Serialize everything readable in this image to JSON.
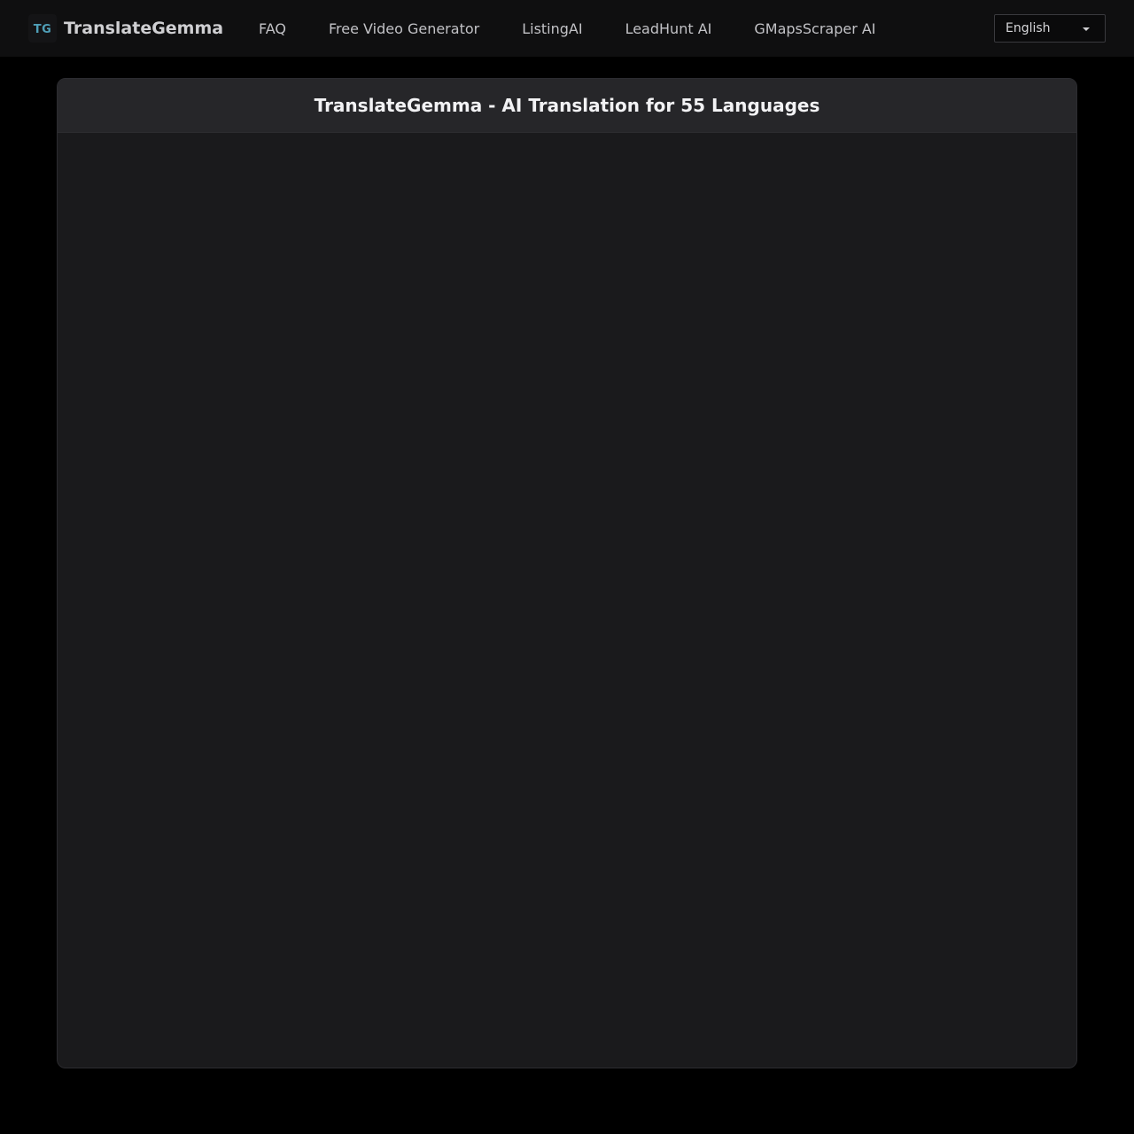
{
  "header": {
    "logo_text": "TG",
    "brand_name": "TranslateGemma",
    "nav": [
      {
        "label": "FAQ"
      },
      {
        "label": "Free Video Generator"
      },
      {
        "label": "ListingAI"
      },
      {
        "label": "LeadHunt AI"
      },
      {
        "label": "GMapsScraper AI"
      }
    ],
    "language": {
      "selected": "English"
    }
  },
  "main": {
    "title": "TranslateGemma - AI Translation for 55 Languages"
  },
  "colors": {
    "background": "#000000",
    "topbar": "#0f0f10",
    "card": "#1a1a1c",
    "card_header": "#262629",
    "logo_accent": "#4f9fb8"
  }
}
